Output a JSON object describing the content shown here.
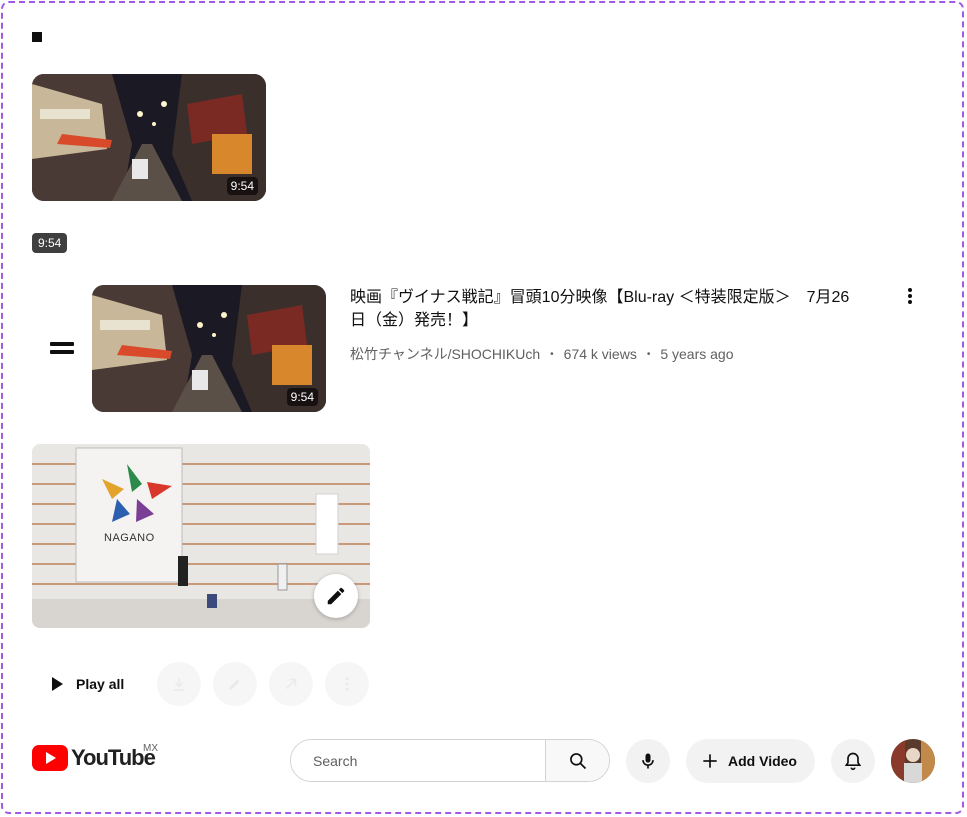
{
  "video": {
    "duration": "9:54",
    "duration_chip": "9:54",
    "title": "映画『ヴイナス戦記』冒頭10分映像【Blu-ray ＜特装限定版＞　7月26日（金）発売！】",
    "channel": "松竹チャンネル/SHOCHIKUch",
    "views": "674 k views",
    "age": "5 years ago"
  },
  "playlist": {
    "play_all_label": "Play all"
  },
  "masthead": {
    "logo_text": "YouTube",
    "country_code": "MX",
    "search_placeholder": "Search",
    "add_video_label": "Add Video"
  },
  "icons": {
    "search": "search-icon",
    "mic": "microphone-icon",
    "plus": "plus-icon",
    "bell": "bell-icon",
    "pencil": "pencil-icon",
    "play": "play-icon",
    "more": "more-vertical-icon",
    "drag": "drag-handle-icon"
  },
  "colors": {
    "brand_red": "#ff0000",
    "frame_border": "#a259e6",
    "meta_text": "#606060"
  }
}
